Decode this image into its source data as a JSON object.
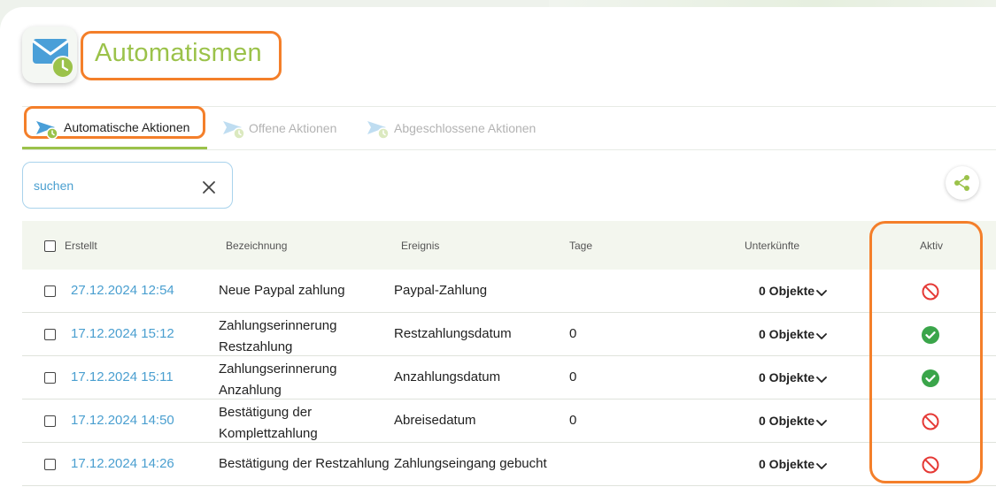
{
  "header": {
    "title": "Automatismen",
    "app_icon": "mail-clock-icon"
  },
  "tabs": [
    {
      "label": "Automatische Aktionen",
      "active": true,
      "icon": "paper-plane-clock-icon"
    },
    {
      "label": "Offene Aktionen",
      "active": false,
      "icon": "paper-plane-clock-icon"
    },
    {
      "label": "Abgeschlossene Aktionen",
      "active": false,
      "icon": "paper-plane-clock-icon"
    }
  ],
  "search": {
    "placeholder": "suchen",
    "value": ""
  },
  "table": {
    "columns": [
      "Erstellt",
      "Bezeichnung",
      "Ereignis",
      "Tage",
      "Unterkünfte",
      "Aktiv"
    ],
    "rows": [
      {
        "created": "27.12.2024 12:54",
        "name": "Neue Paypal zahlung",
        "event": "Paypal-Zahlung",
        "days": "",
        "accommodations": "0 Objekte",
        "active": false
      },
      {
        "created": "17.12.2024 15:12",
        "name": "Zahlungserinnerung Restzahlung",
        "event": "Restzahlungsdatum",
        "days": "0",
        "accommodations": "0 Objekte",
        "active": true
      },
      {
        "created": "17.12.2024 15:11",
        "name": "Zahlungserinnerung Anzahlung",
        "event": "Anzahlungsdatum",
        "days": "0",
        "accommodations": "0 Objekte",
        "active": true
      },
      {
        "created": "17.12.2024 14:50",
        "name": "Bestätigung der Komplettzahlung",
        "event": "Abreisedatum",
        "days": "0",
        "accommodations": "0 Objekte",
        "active": false
      },
      {
        "created": "17.12.2024 14:26",
        "name": "Bestätigung der Restzahlung",
        "event": "Zahlungseingang gebucht",
        "days": "",
        "accommodations": "0 Objekte",
        "active": false
      }
    ]
  },
  "colors": {
    "accent_green": "#9bc24a",
    "link_blue": "#4a9fd0",
    "highlight_orange": "#f47f2a",
    "active_green": "#3aa54a",
    "inactive_red": "#e53935"
  }
}
